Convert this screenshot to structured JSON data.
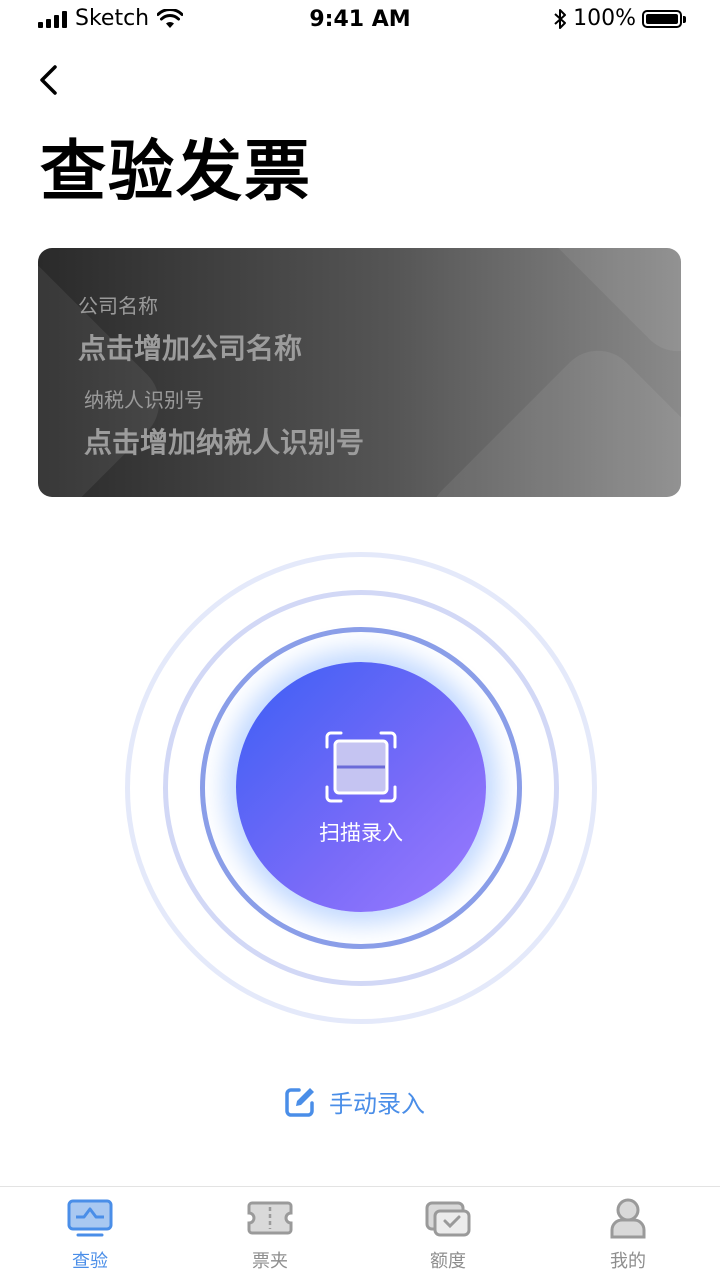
{
  "status_bar": {
    "carrier": "Sketch",
    "time": "9:41 AM",
    "battery": "100%"
  },
  "page": {
    "title": "查验发票"
  },
  "company_card": {
    "company_label": "公司名称",
    "company_placeholder": "点击增加公司名称",
    "tax_label": "纳税人识别号",
    "tax_placeholder": "点击增加纳税人识别号"
  },
  "scan": {
    "label": "扫描录入"
  },
  "manual": {
    "label": "手动录入"
  },
  "tabs": [
    {
      "label": "查验",
      "icon": "monitor-icon",
      "active": true
    },
    {
      "label": "票夹",
      "icon": "ticket-icon",
      "active": false
    },
    {
      "label": "额度",
      "icon": "quota-icon",
      "active": false
    },
    {
      "label": "我的",
      "icon": "user-icon",
      "active": false
    }
  ],
  "colors": {
    "accent": "#4a8ee8",
    "scan_start": "#3b5ff5",
    "scan_end": "#9c7cff",
    "inactive": "#8e8e8e"
  }
}
